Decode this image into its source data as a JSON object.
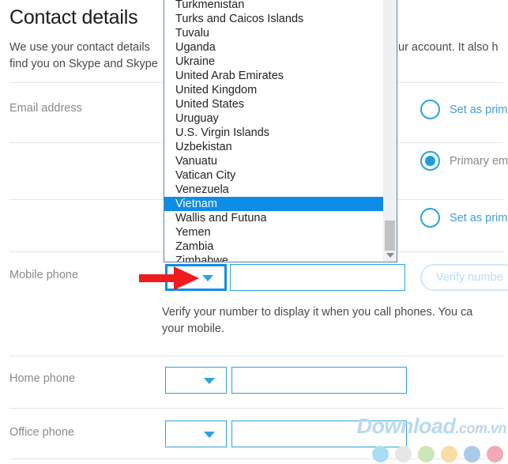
{
  "header": {
    "title": "Contact details",
    "description_line1": "We use your contact details",
    "description_line2": "find you on Skype and Skype",
    "description_right_fragment": "ur account. It also h"
  },
  "rows": {
    "email": {
      "label": "Email address",
      "options": [
        {
          "label": "Set as prim",
          "checked": false
        },
        {
          "label": "Primary em",
          "checked": true
        },
        {
          "label": "Set as prim",
          "checked": false
        }
      ]
    },
    "mobile_phone": {
      "label": "Mobile phone",
      "country_value": "",
      "number_value": "",
      "verify_button_label": "Verify numbe",
      "note_line1": "Verify your number to display it when you call phones. You ca",
      "note_line2": "your mobile."
    },
    "home_phone": {
      "label": "Home phone",
      "country_value": "",
      "number_value": ""
    },
    "office_phone": {
      "label": "Office phone",
      "country_value": "",
      "number_value": ""
    }
  },
  "country_dropdown": {
    "selected": "Vietnam",
    "items": [
      "Turkmenistan",
      "Turks and Caicos Islands",
      "Tuvalu",
      "Uganda",
      "Ukraine",
      "United Arab Emirates",
      "United Kingdom",
      "United States",
      "Uruguay",
      "U.S. Virgin Islands",
      "Uzbekistan",
      "Vanuatu",
      "Vatican City",
      "Venezuela",
      "Vietnam",
      "Wallis and Futuna",
      "Yemen",
      "Zambia",
      "Zimbabwe"
    ]
  },
  "annotation": {
    "arrow_color": "#ee1c1c",
    "arrow_direction": "right",
    "points_at": "mobile-phone-country-select"
  },
  "watermark": {
    "text_main": "Download",
    "text_suffix": ".com.vn",
    "dot_colors": [
      "#a9ddf4",
      "#e6e6e6",
      "#cce6b8",
      "#fbdca6",
      "#a8cbe8",
      "#f4a8b2"
    ]
  },
  "colors": {
    "accent_blue": "#2aa3e5",
    "focus_blue": "#0d8de8",
    "highlight_blue": "#0d8de8",
    "label_gray": "#8a8a8a",
    "divider_gray": "#e6e6e6"
  }
}
